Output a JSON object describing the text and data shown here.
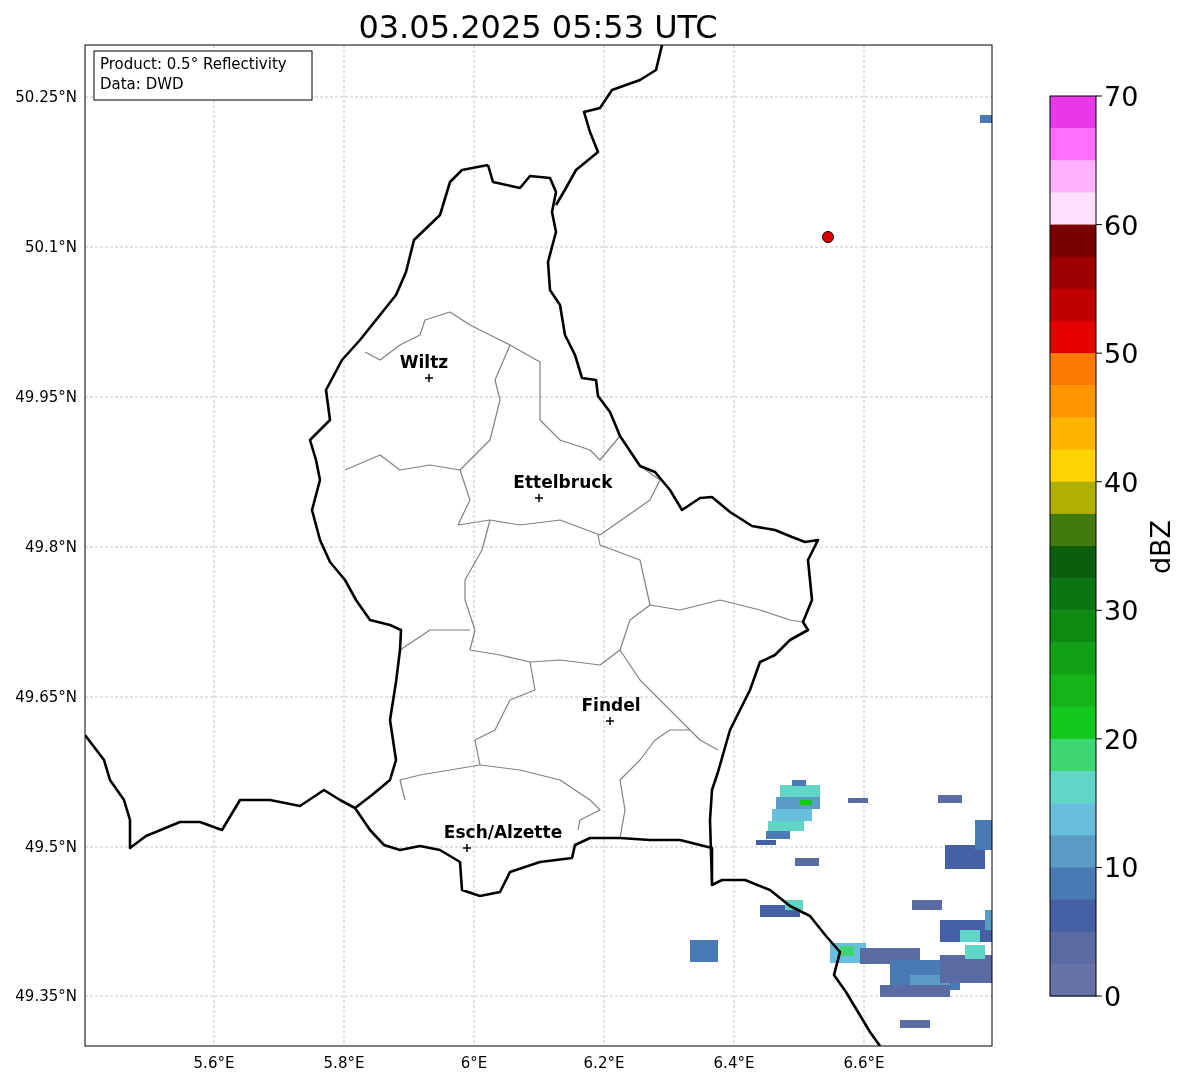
{
  "title": "03.05.2025 05:53 UTC",
  "info_box": [
    "Product: 0.5° Reflectivity",
    "Data: DWD"
  ],
  "cities": [
    {
      "name": "Wiltz"
    },
    {
      "name": "Ettelbruck"
    },
    {
      "name": "Findel"
    },
    {
      "name": "Esch/Alzette"
    }
  ],
  "y_ticks": [
    "50.25°N",
    "50.1°N",
    "49.95°N",
    "49.8°N",
    "49.65°N",
    "49.5°N",
    "49.35°N"
  ],
  "x_ticks": [
    "5.6°E",
    "5.8°E",
    "6°E",
    "6.2°E",
    "6.4°E",
    "6.6°E"
  ],
  "colorbar": {
    "label": "dBZ",
    "ticks": [
      "70",
      "60",
      "50",
      "40",
      "30",
      "20",
      "10",
      "0"
    ],
    "bins": [
      {
        "color": "#e838e8"
      },
      {
        "color": "#ff6eff"
      },
      {
        "color": "#ffb0ff"
      },
      {
        "color": "#ffe0ff"
      },
      {
        "color": "#7a0000"
      },
      {
        "color": "#9d0000"
      },
      {
        "color": "#c10000"
      },
      {
        "color": "#e50000"
      },
      {
        "color": "#ff7a00"
      },
      {
        "color": "#ff9600"
      },
      {
        "color": "#ffb400"
      },
      {
        "color": "#ffd400"
      },
      {
        "color": "#b0b000"
      },
      {
        "color": "#437a10"
      },
      {
        "color": "#0a5e0c"
      },
      {
        "color": "#0a7612"
      },
      {
        "color": "#0e8a12"
      },
      {
        "color": "#12a015"
      },
      {
        "color": "#14b41a"
      },
      {
        "color": "#12c81e"
      },
      {
        "color": "#3ed672"
      },
      {
        "color": "#62d6c6"
      },
      {
        "color": "#68bfdd"
      },
      {
        "color": "#5a9cc6"
      },
      {
        "color": "#4a7ab3"
      },
      {
        "color": "#4560a5"
      },
      {
        "color": "#5a6aa3"
      },
      {
        "color": "#6673a6"
      }
    ]
  }
}
